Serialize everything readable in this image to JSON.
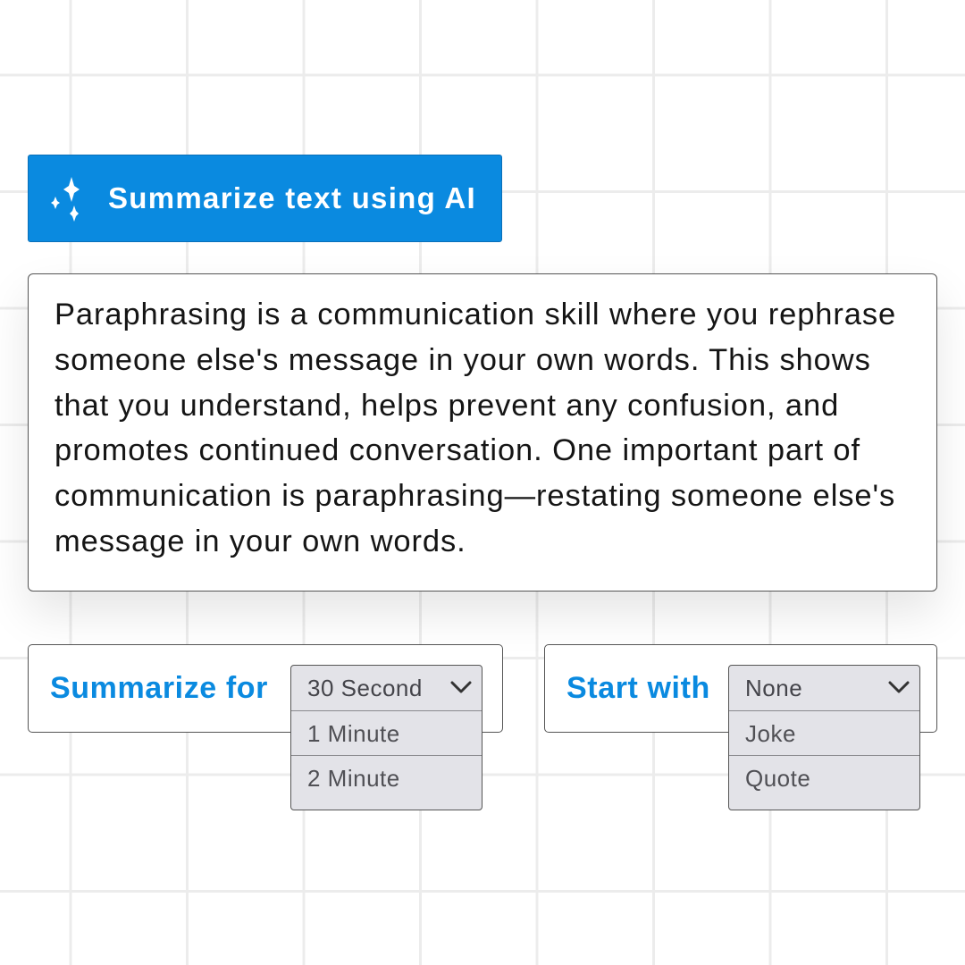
{
  "ai_button": {
    "label": "Summarize text using AI",
    "icon": "sparkle-icon",
    "color": "#0a8ae0"
  },
  "text_card": {
    "text": "Paraphrasing is a communication skill where you rephrase someone else's message in your own words. This shows that you understand, helps prevent any confusion, and promotes continued conversation. One important part of communication is paraphrasing—restating someone else's message in your own words."
  },
  "summarize_for": {
    "label": "Summarize for",
    "options": [
      {
        "label": "30 Second",
        "selected": true
      },
      {
        "label": "1 Minute",
        "selected": false
      },
      {
        "label": "2 Minute",
        "selected": false
      }
    ]
  },
  "start_with": {
    "label": "Start with",
    "options": [
      {
        "label": "None",
        "selected": true
      },
      {
        "label": "Joke",
        "selected": false
      },
      {
        "label": "Quote",
        "selected": false
      }
    ]
  },
  "colors": {
    "accent": "#0a8ae0",
    "dropdown_bg": "#e3e3e8",
    "grid": "#ececec"
  }
}
